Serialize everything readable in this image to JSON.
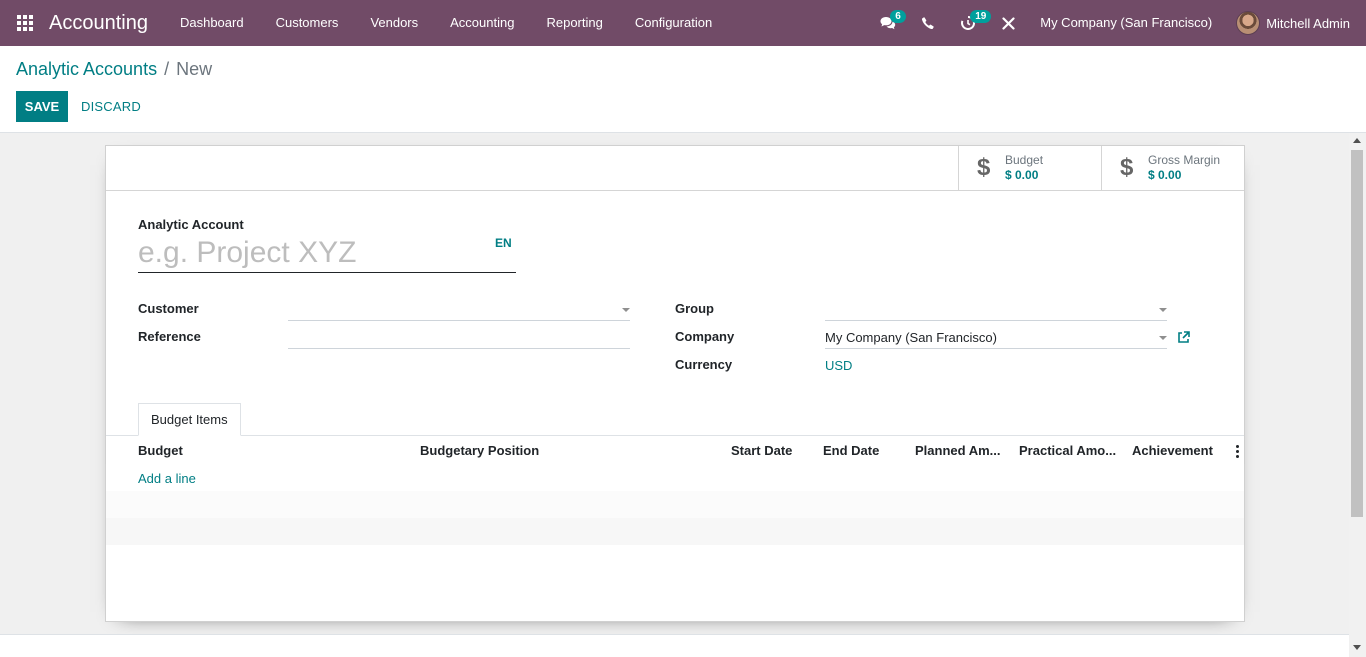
{
  "navbar": {
    "app_title": "Accounting",
    "menu": [
      "Dashboard",
      "Customers",
      "Vendors",
      "Accounting",
      "Reporting",
      "Configuration"
    ],
    "messages_count": "6",
    "activities_count": "19",
    "company": "My Company (San Francisco)",
    "user": "Mitchell Admin",
    "icons": {
      "apps": "apps-grid-icon",
      "messages": "chat-bubbles-icon",
      "phone": "phone-icon",
      "activities": "clock-icon",
      "debug": "tools-icon"
    },
    "colors": {
      "bar": "#714b67",
      "badge": "#00a09d"
    }
  },
  "breadcrumb": {
    "parent": "Analytic Accounts",
    "separator": "/",
    "current": "New"
  },
  "toolbar": {
    "save_label": "SAVE",
    "discard_label": "DISCARD"
  },
  "stat_buttons": [
    {
      "label": "Budget",
      "value": "$ 0.00",
      "icon": "dollar-icon"
    },
    {
      "label": "Gross Margin",
      "value": "$ 0.00",
      "icon": "dollar-icon"
    }
  ],
  "form": {
    "title_label": "Analytic Account",
    "name_placeholder": "e.g. Project XYZ",
    "name_value": "",
    "lang": "EN",
    "left_fields": [
      {
        "label": "Customer",
        "value": ""
      },
      {
        "label": "Reference",
        "value": ""
      }
    ],
    "right_fields": {
      "group_label": "Group",
      "group_value": "",
      "company_label": "Company",
      "company_value": "My Company (San Francisco)",
      "currency_label": "Currency",
      "currency_value": "USD"
    }
  },
  "notebook": {
    "tab_label": "Budget Items",
    "columns": [
      "Budget",
      "Budgetary Position",
      "Start Date",
      "End Date",
      "Planned Am...",
      "Practical Amo...",
      "Achievement"
    ],
    "add_line": "Add a line"
  },
  "colors": {
    "primary": "#017e84"
  }
}
